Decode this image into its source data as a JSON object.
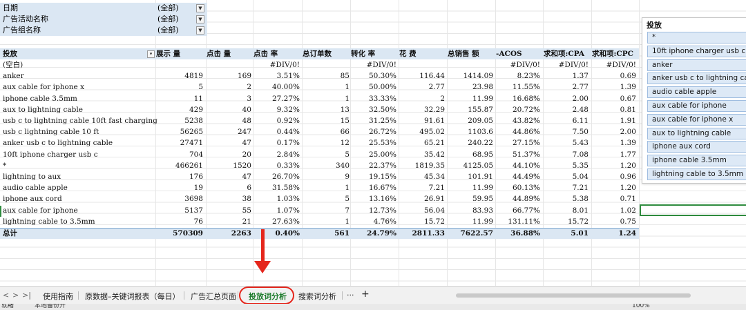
{
  "filters": [
    {
      "label": "日期",
      "value": "(全部)"
    },
    {
      "label": "广告活动名称",
      "value": "(全部)"
    },
    {
      "label": "广告组名称",
      "value": "(全部)"
    }
  ],
  "table": {
    "headers": [
      "投放",
      "展示 量",
      "点击 量",
      "点击 率",
      "总订单数",
      "转化 率",
      "花 费",
      "总销售 额",
      "-ACOS",
      "求和项:CPA",
      "求和项:CPC"
    ],
    "rows": [
      [
        "(空白)",
        "",
        "",
        "#DIV/0!",
        "",
        "#DIV/0!",
        "",
        "",
        "#DIV/0!",
        "#DIV/0!",
        "#DIV/0!"
      ],
      [
        "anker",
        "4819",
        "169",
        "3.51%",
        "85",
        "50.30%",
        "116.44",
        "1414.09",
        "8.23%",
        "1.37",
        "0.69"
      ],
      [
        "aux cable for iphone x",
        "5",
        "2",
        "40.00%",
        "1",
        "50.00%",
        "2.77",
        "23.98",
        "11.55%",
        "2.77",
        "1.39"
      ],
      [
        "iphone cable 3.5mm",
        "11",
        "3",
        "27.27%",
        "1",
        "33.33%",
        "2",
        "11.99",
        "16.68%",
        "2.00",
        "0.67"
      ],
      [
        "aux to lightning cable",
        "429",
        "40",
        "9.32%",
        "13",
        "32.50%",
        "32.29",
        "155.87",
        "20.72%",
        "2.48",
        "0.81"
      ],
      [
        "usb c to lightning cable 10ft fast charging",
        "5238",
        "48",
        "0.92%",
        "15",
        "31.25%",
        "91.61",
        "209.05",
        "43.82%",
        "6.11",
        "1.91"
      ],
      [
        "usb c lightning cable 10 ft",
        "56265",
        "247",
        "0.44%",
        "66",
        "26.72%",
        "495.02",
        "1103.6",
        "44.86%",
        "7.50",
        "2.00"
      ],
      [
        "anker usb c to lightning cable",
        "27471",
        "47",
        "0.17%",
        "12",
        "25.53%",
        "65.21",
        "240.22",
        "27.15%",
        "5.43",
        "1.39"
      ],
      [
        "10ft iphone charger usb c",
        "704",
        "20",
        "2.84%",
        "5",
        "25.00%",
        "35.42",
        "68.95",
        "51.37%",
        "7.08",
        "1.77"
      ],
      [
        "*",
        "466261",
        "1520",
        "0.33%",
        "340",
        "22.37%",
        "1819.35",
        "4125.05",
        "44.10%",
        "5.35",
        "1.20"
      ],
      [
        "lightning to aux",
        "176",
        "47",
        "26.70%",
        "9",
        "19.15%",
        "45.34",
        "101.91",
        "44.49%",
        "5.04",
        "0.96"
      ],
      [
        "audio cable apple",
        "19",
        "6",
        "31.58%",
        "1",
        "16.67%",
        "7.21",
        "11.99",
        "60.13%",
        "7.21",
        "1.20"
      ],
      [
        "iphone aux cord",
        "3698",
        "38",
        "1.03%",
        "5",
        "13.16%",
        "26.91",
        "59.95",
        "44.89%",
        "5.38",
        "0.71"
      ],
      [
        "aux cable for iphone",
        "5137",
        "55",
        "1.07%",
        "7",
        "12.73%",
        "56.04",
        "83.93",
        "66.77%",
        "8.01",
        "1.02"
      ],
      [
        "lightning cable to 3.5mm",
        "76",
        "21",
        "27.63%",
        "1",
        "4.76%",
        "15.72",
        "11.99",
        "131.11%",
        "15.72",
        "0.75"
      ]
    ],
    "total": [
      "总计",
      "570309",
      "2263",
      "0.40%",
      "561",
      "24.79%",
      "2811.33",
      "7622.57",
      "36.88%",
      "5.01",
      "1.24"
    ]
  },
  "slicer": {
    "title": "投放",
    "items": [
      "*",
      "10ft iphone charger usb c",
      "anker",
      "anker usb c to lightning cable",
      "audio cable apple",
      "aux cable for iphone",
      "aux cable for iphone x",
      "aux to lightning cable",
      "iphone aux cord",
      "iphone cable 3.5mm",
      "lightning cable to 3.5mm"
    ]
  },
  "tabs": {
    "nav": [
      "<",
      ">",
      ">|"
    ],
    "items": [
      "使用指南",
      "原数据–关键词报表（每日）",
      "广告汇总页面",
      "投放词分析",
      "搜索词分析"
    ],
    "active": "投放词分析",
    "more": "···",
    "add": "+"
  },
  "status": {
    "mode": "就绪",
    "backup": "本地备份开",
    "zoom": "100%"
  },
  "colors": {
    "header_fill": "#dbe7f3",
    "slicer_item_fill": "#dde9f6",
    "active_tab": "#1e7c2d",
    "annotation": "#e5261c"
  }
}
